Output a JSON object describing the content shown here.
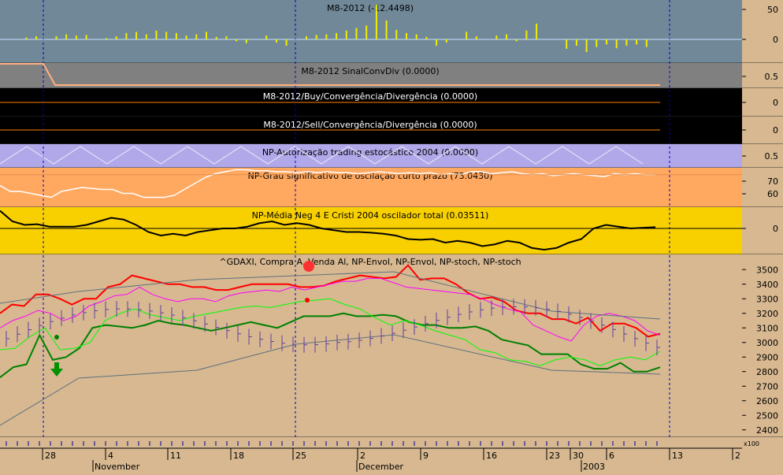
{
  "panels": [
    {
      "id": "m8",
      "title": "M8-2012 (-12.4498)",
      "ticks": [
        "50",
        "0"
      ],
      "bg": "#708898"
    },
    {
      "id": "sinal",
      "title": "M8-2012 SinalConvDiv (0.0000)",
      "ticks": [
        "0.5"
      ],
      "bg": "#808080"
    },
    {
      "id": "buy",
      "title": "M8-2012/Buy/Convergência/Divergência (0.0000)",
      "ticks": [
        "0"
      ],
      "bg": "#000000"
    },
    {
      "id": "sell",
      "title": "M8-2012/Sell/Convergência/Divergência (0.0000)",
      "ticks": [
        "0"
      ],
      "bg": "#000000"
    },
    {
      "id": "autor",
      "title": "NP-Autorização trading estocástico 2004 (0.0000)",
      "ticks": [
        "0.5"
      ],
      "bg": "#b0a8e8"
    },
    {
      "id": "grau",
      "title": "NP-Grau significativo de oscilação curto prazo (73.0430)",
      "ticks": [
        "70",
        "60"
      ],
      "bg": "#ffa860"
    },
    {
      "id": "media",
      "title": "NP-Média Neg 4 E Cristi 2004 oscilador total (0.03511)",
      "ticks": [
        "0"
      ],
      "bg": "#f8d000"
    },
    {
      "id": "price",
      "title": "^GDAXI, Compra A, Venda Al, NP-Envol, NP-Envol, NP-stoch, NP-stoch",
      "ticks": [
        "3500",
        "3400",
        "3300",
        "3200",
        "3100",
        "3000",
        "2900",
        "2800",
        "2700",
        "2600",
        "2500",
        "2400"
      ],
      "bg": "#d7b890"
    }
  ],
  "x_axis": {
    "day_labels": [
      "28",
      "4",
      "11",
      "18",
      "25",
      "2",
      "9",
      "16",
      "23",
      "30",
      "6",
      "13",
      "2"
    ],
    "month_labels": [
      "November",
      "December",
      "2003"
    ],
    "scale_note": "x100"
  },
  "colors": {
    "upper_envelope": "#ff0000",
    "lower_envelope": "#008000",
    "stoch_fast": "#ff00ff",
    "stoch_slow": "#00ff00",
    "band": "#607080",
    "oscillator": "#f0f000"
  },
  "chart_data": [
    {
      "type": "bar",
      "title": "M8-2012 (-12.4498)",
      "ylim": [
        -20,
        60
      ],
      "values": [
        0,
        0,
        3,
        5,
        0,
        5,
        8,
        6,
        7,
        0,
        2,
        5,
        10,
        12,
        8,
        14,
        12,
        10,
        6,
        8,
        12,
        4,
        5,
        -3,
        -6,
        0,
        6,
        -5,
        -10,
        0,
        5,
        7,
        8,
        10,
        14,
        18,
        22,
        55,
        30,
        15,
        10,
        8,
        4,
        -10,
        -5,
        0,
        12,
        5,
        0,
        6,
        8,
        -3,
        14,
        25,
        0,
        0,
        -15,
        -10,
        -20,
        -12,
        -8,
        -14,
        -10,
        -8,
        -12
      ]
    },
    {
      "type": "line",
      "title": "NP-Grau significativo de oscilação curto prazo (73.0430)",
      "ylim": [
        40,
        80
      ],
      "values": [
        62,
        56,
        56,
        54,
        52,
        50,
        56,
        58,
        60,
        59,
        58,
        58,
        54,
        54,
        50,
        50,
        50,
        52,
        58,
        64,
        70,
        74,
        76,
        78,
        78,
        77,
        77,
        76,
        76,
        75,
        76,
        75,
        76,
        75,
        75,
        74,
        75,
        76,
        75,
        74,
        75,
        74,
        75,
        73,
        74,
        73,
        76,
        76,
        74,
        75,
        76,
        74,
        73,
        74,
        72,
        73,
        74,
        73,
        72,
        71,
        74,
        73,
        74,
        73,
        73.04
      ]
    },
    {
      "type": "line",
      "title": "NP-Média Neg 4 E Cristi 2004 oscilador total (0.03511)",
      "values": [
        0.5,
        0.2,
        0.1,
        0.12,
        0.05,
        0.05,
        0.05,
        0.1,
        0.2,
        0.3,
        0.25,
        0.1,
        -0.1,
        -0.2,
        -0.15,
        -0.2,
        -0.1,
        -0.05,
        0.0,
        0.0,
        0.05,
        0.15,
        0.2,
        0.1,
        0.15,
        0.1,
        0.0,
        -0.05,
        -0.1,
        -0.1,
        -0.12,
        -0.15,
        -0.2,
        -0.3,
        -0.32,
        -0.3,
        -0.4,
        -0.35,
        -0.4,
        -0.5,
        -0.45,
        -0.35,
        -0.4,
        -0.55,
        -0.6,
        -0.55,
        -0.4,
        -0.3,
        0.0,
        0.1,
        0.05,
        0.0,
        0.02,
        0.03511
      ]
    },
    {
      "type": "line",
      "title": "^GDAXI, Compra A, Venda Al, NP-Envol, NP-Envol, NP-stoch, NP-stoch",
      "ylim": [
        2350,
        3550
      ],
      "series": [
        {
          "name": "NP-Envol",
          "values": [
            3200,
            3260,
            3250,
            3330,
            3330,
            3300,
            3260,
            3300,
            3300,
            3380,
            3400,
            3460,
            3440,
            3420,
            3400,
            3400,
            3380,
            3380,
            3360,
            3360,
            3380,
            3400,
            3400,
            3400,
            3400,
            3380,
            3380,
            3390,
            3420,
            3440,
            3460,
            3450,
            3440,
            3450,
            3530,
            3430,
            3440,
            3440,
            3400,
            3340,
            3300,
            3310,
            3280,
            3220,
            3200,
            3200,
            3160,
            3160,
            3130,
            3170,
            3080,
            3130,
            3130,
            3100,
            3040,
            3060
          ]
        },
        {
          "name": "NP-Envol",
          "values": [
            2760,
            2830,
            2850,
            3050,
            2880,
            2900,
            2960,
            3100,
            3120,
            3110,
            3100,
            3120,
            3150,
            3130,
            3120,
            3100,
            3080,
            3100,
            3120,
            3140,
            3120,
            3100,
            3140,
            3180,
            3180,
            3180,
            3200,
            3180,
            3180,
            3190,
            3180,
            3140,
            3120,
            3120,
            3100,
            3100,
            3110,
            3080,
            3020,
            3000,
            2980,
            2920,
            2920,
            2920,
            2850,
            2820,
            2820,
            2860,
            2800,
            2800,
            2830
          ]
        },
        {
          "name": "NP-stoch",
          "values": [
            3100,
            3150,
            3180,
            3220,
            3200,
            3150,
            3180,
            3250,
            3280,
            3320,
            3330,
            3380,
            3330,
            3300,
            3280,
            3300,
            3300,
            3280,
            3320,
            3340,
            3350,
            3360,
            3350,
            3380,
            3360,
            3380,
            3400,
            3420,
            3420,
            3440,
            3440,
            3410,
            3380,
            3370,
            3360,
            3350,
            3340,
            3330,
            3300,
            3260,
            3230,
            3210,
            3120,
            3080,
            3040,
            3010,
            3120,
            3180,
            3200,
            3180,
            3150,
            3080,
            3050
          ]
        },
        {
          "name": "NP-stoch",
          "values": [
            2950,
            2960,
            3040,
            3100,
            2950,
            2960,
            3000,
            3150,
            3200,
            3230,
            3190,
            3170,
            3150,
            3180,
            3200,
            3220,
            3240,
            3250,
            3240,
            3260,
            3280,
            3290,
            3300,
            3260,
            3230,
            3170,
            3120,
            3150,
            3120,
            3080,
            3050,
            3020,
            2950,
            2930,
            2880,
            2870,
            2840,
            2880,
            2900,
            2880,
            2840,
            2880,
            2900,
            2880,
            2940
          ]
        }
      ]
    }
  ]
}
